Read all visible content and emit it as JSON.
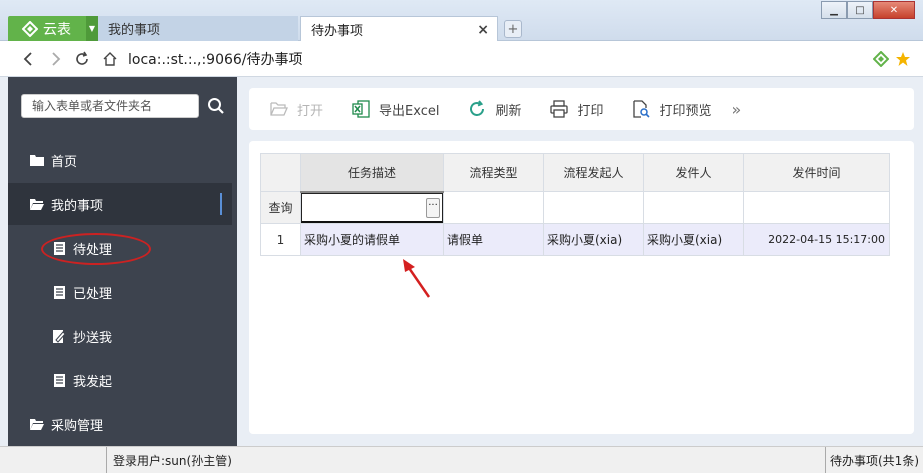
{
  "browser": {
    "brand_name": "云表",
    "tabs": [
      {
        "label": "我的事项"
      },
      {
        "label": "待办事项",
        "close": "×"
      }
    ],
    "new_tab": "+",
    "url": "loca:.:st.:.,:9066/待办事项"
  },
  "sidebar": {
    "search_placeholder": "输入表单或者文件夹名",
    "items": [
      {
        "label": "首页",
        "icon": "folder-icon"
      },
      {
        "label": "我的事项",
        "icon": "folder-open-icon"
      },
      {
        "label": "待处理",
        "icon": "document-icon"
      },
      {
        "label": "已处理",
        "icon": "document-icon"
      },
      {
        "label": "抄送我",
        "icon": "edit-document-icon"
      },
      {
        "label": "我发起",
        "icon": "document-icon"
      },
      {
        "label": "采购管理",
        "icon": "folder-icon"
      }
    ]
  },
  "toolbar": {
    "open": "打开",
    "export_excel": "导出Excel",
    "refresh": "刷新",
    "print": "打印",
    "print_preview": "打印预览",
    "more": "»"
  },
  "grid": {
    "columns": [
      "任务描述",
      "流程类型",
      "流程发起人",
      "发件人",
      "发件时间"
    ],
    "filter_label": "查询",
    "filter_button": "···",
    "rows": [
      {
        "num": "1",
        "task": "采购小夏的请假单",
        "type": "请假单",
        "initiator": "采购小夏(xia)",
        "sender": "采购小夏(xia)",
        "time": "2022-04-15 15:17:00"
      }
    ]
  },
  "status": {
    "user": "登录用户:sun(孙主管)",
    "summary": "待办事项(共1条)"
  },
  "colors": {
    "brand_green": "#62b34a",
    "sidebar_bg": "#3d434e",
    "annotation_red": "#cc2222",
    "row_highlight": "#ebebfa"
  }
}
